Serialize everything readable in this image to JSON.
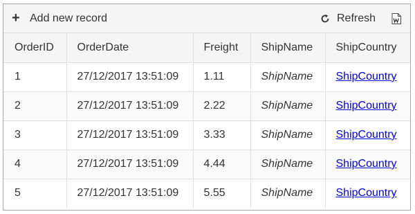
{
  "toolbar": {
    "add_label": "Add new record",
    "add_icon": "plus-icon",
    "refresh_label": "Refresh",
    "refresh_icon": "refresh-icon",
    "export_icon": "word-export-icon"
  },
  "table": {
    "columns": [
      "OrderID",
      "OrderDate",
      "Freight",
      "ShipName",
      "ShipCountry"
    ],
    "rows": [
      {
        "id": "1",
        "date": "27/12/2017 13:51:09",
        "freight": "1.11",
        "shipname": "ShipName",
        "shipcountry": "ShipCountry"
      },
      {
        "id": "2",
        "date": "27/12/2017 13:51:09",
        "freight": "2.22",
        "shipname": "ShipName",
        "shipcountry": "ShipCountry"
      },
      {
        "id": "3",
        "date": "27/12/2017 13:51:09",
        "freight": "3.33",
        "shipname": "ShipName",
        "shipcountry": "ShipCountry"
      },
      {
        "id": "4",
        "date": "27/12/2017 13:51:09",
        "freight": "4.44",
        "shipname": "ShipName",
        "shipcountry": "ShipCountry"
      },
      {
        "id": "5",
        "date": "27/12/2017 13:51:09",
        "freight": "5.55",
        "shipname": "ShipName",
        "shipcountry": "ShipCountry"
      }
    ]
  },
  "colors": {
    "link": "#0000ee",
    "header_bg": "#f5f5f5",
    "border": "#e0e0e0"
  }
}
